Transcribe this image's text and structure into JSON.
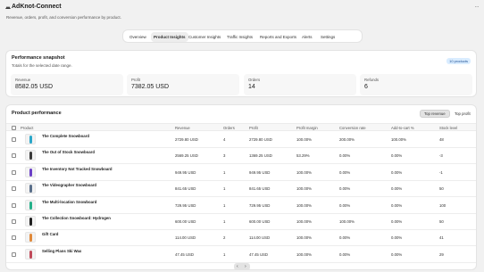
{
  "header": {
    "title": "AdKnot-Connect",
    "subtitle": "Revenue, orders, profit, and conversion performance by product.",
    "menu_label": "···"
  },
  "tabs": [
    {
      "label": "Overview"
    },
    {
      "label": "Product Insights"
    },
    {
      "label": "Customer Insights"
    },
    {
      "label": "Traffic Insights"
    },
    {
      "label": "Reports and Exports"
    },
    {
      "label": "Alerts"
    },
    {
      "label": "Settings"
    }
  ],
  "active_tab": "Product Insights",
  "snapshot": {
    "title": "Performance snapshot",
    "subtitle": "Totals for the selected date range.",
    "badge": "10 products",
    "stats": [
      {
        "label": "Revenue",
        "value": "8582.05 USD"
      },
      {
        "label": "Profit",
        "value": "7382.05 USD"
      },
      {
        "label": "Orders",
        "value": "14"
      },
      {
        "label": "Refunds",
        "value": "6"
      }
    ]
  },
  "performance": {
    "title": "Product performance",
    "sort_buttons": [
      {
        "label": "Top revenue",
        "active": true
      },
      {
        "label": "Top profit",
        "active": false
      }
    ],
    "columns": [
      "Product",
      "Revenue",
      "Orders",
      "Profit",
      "Profit margin",
      "Conversion rate",
      "Add-to-cart %",
      "Stock level"
    ],
    "rows": [
      {
        "name": "The Complete Snowboard",
        "revenue": "2729.80 USD",
        "orders": "4",
        "profit": "2729.80 USD",
        "margin": "100.00%",
        "conversion": "200.00%",
        "atc": "100.00%",
        "stock": "48",
        "color": "#2aa7c9"
      },
      {
        "name": "The Out of Stock Snowboard",
        "revenue": "2569.25 USD",
        "orders": "3",
        "profit": "1369.25 USD",
        "margin": "53.29%",
        "conversion": "0.00%",
        "atc": "0.00%",
        "stock": "-3",
        "color": "#3a3a3a"
      },
      {
        "name": "The Inventory Not Tracked Snowboard",
        "revenue": "949.95 USD",
        "orders": "1",
        "profit": "949.95 USD",
        "margin": "100.00%",
        "conversion": "0.00%",
        "atc": "0.00%",
        "stock": "-1",
        "color": "#6b3fc7"
      },
      {
        "name": "The Videographer Snowboard",
        "revenue": "841.65 USD",
        "orders": "1",
        "profit": "841.65 USD",
        "margin": "100.00%",
        "conversion": "0.00%",
        "atc": "0.00%",
        "stock": "50",
        "color": "#5a6f8a"
      },
      {
        "name": "The Multi-location Snowboard",
        "revenue": "729.95 USD",
        "orders": "1",
        "profit": "729.95 USD",
        "margin": "100.00%",
        "conversion": "0.00%",
        "atc": "0.00%",
        "stock": "100",
        "color": "#24b089"
      },
      {
        "name": "The Collection Snowboard: Hydrogen",
        "revenue": "600.00 USD",
        "orders": "1",
        "profit": "600.00 USD",
        "margin": "100.00%",
        "conversion": "100.00%",
        "atc": "0.00%",
        "stock": "50",
        "color": "#1f1f1f"
      },
      {
        "name": "Gift Card",
        "revenue": "114.00 USD",
        "orders": "2",
        "profit": "114.00 USD",
        "margin": "100.00%",
        "conversion": "0.00%",
        "atc": "0.00%",
        "stock": "41",
        "color": "#e0893a"
      },
      {
        "name": "Selling Plans Ski Wax",
        "revenue": "47.45 USD",
        "orders": "1",
        "profit": "47.45 USD",
        "margin": "100.00%",
        "conversion": "0.00%",
        "atc": "0.00%",
        "stock": "29",
        "color": "#c04a5a"
      }
    ]
  },
  "pager": {
    "prev": "‹",
    "next": "›"
  }
}
